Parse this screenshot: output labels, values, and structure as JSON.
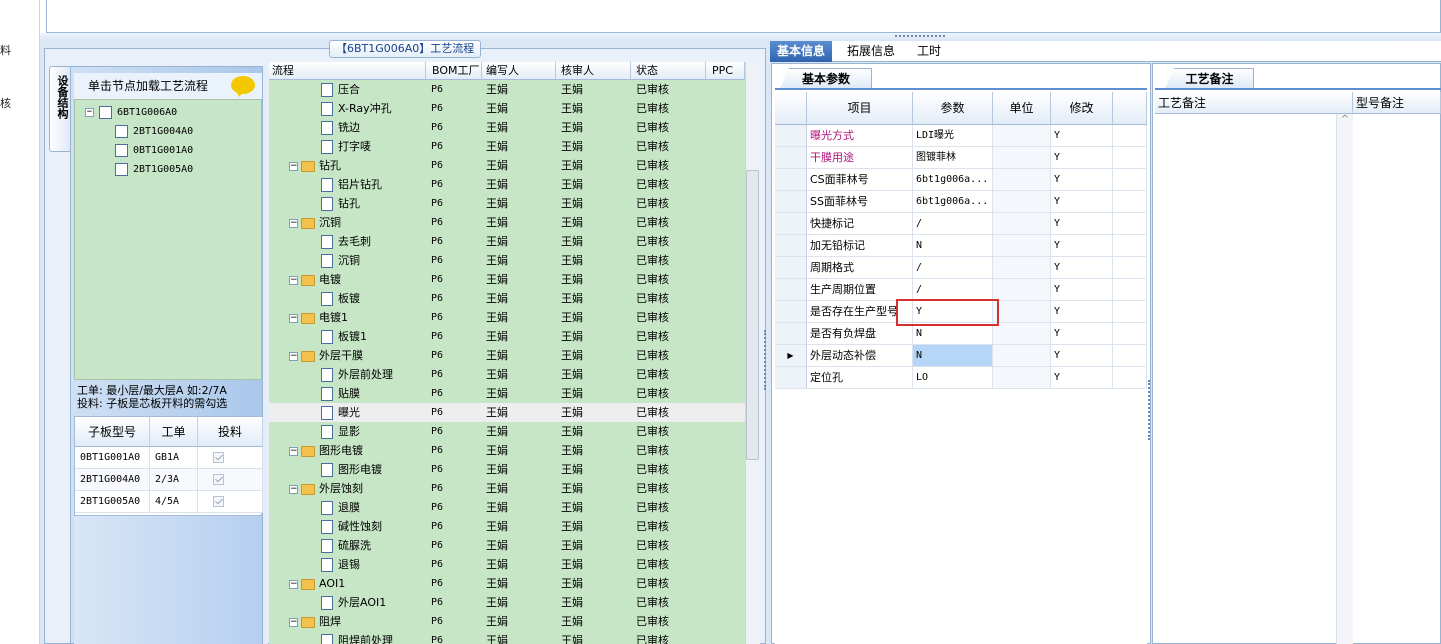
{
  "left_strip": [
    "料",
    "核"
  ],
  "main_title": "【6BT1G006A0】工艺流程",
  "vertical_tab": "设备结构",
  "load_header": "单击节点加载工艺流程",
  "device_tree": {
    "root": "6BT1G006A0",
    "children": [
      "2BT1G004A0",
      "0BT1G001A0",
      "2BT1G005A0"
    ]
  },
  "notes": {
    "line1": "工单: 最小层/最大层A 如:2/7A",
    "line2": "投料: 子板是芯板开料的需勾选"
  },
  "sub_table": {
    "headers": [
      "子板型号",
      "工单",
      "投料"
    ],
    "rows": [
      {
        "model": "0BT1G001A0",
        "order": "GB1A",
        "checked": true
      },
      {
        "model": "2BT1G004A0",
        "order": "2/3A",
        "checked": true
      },
      {
        "model": "2BT1G005A0",
        "order": "4/5A",
        "checked": true
      }
    ]
  },
  "process_grid": {
    "headers": [
      "流程",
      "BOM工厂",
      "编写人",
      "核审人",
      "状态",
      "PPC"
    ],
    "rows": [
      {
        "name": "压合",
        "level": 2,
        "bom": "P6",
        "writer": "王娟",
        "reviewer": "王娟",
        "status": "已审核"
      },
      {
        "name": "X-Ray冲孔",
        "level": 2,
        "bom": "P6",
        "writer": "王娟",
        "reviewer": "王娟",
        "status": "已审核"
      },
      {
        "name": "铣边",
        "level": 2,
        "bom": "P6",
        "writer": "王娟",
        "reviewer": "王娟",
        "status": "已审核"
      },
      {
        "name": "打字唛",
        "level": 2,
        "bom": "P6",
        "writer": "王娟",
        "reviewer": "王娟",
        "status": "已审核"
      },
      {
        "name": "钻孔",
        "level": 1,
        "bom": "P6",
        "writer": "王娟",
        "reviewer": "王娟",
        "status": "已审核"
      },
      {
        "name": "铝片钻孔",
        "level": 2,
        "bom": "P6",
        "writer": "王娟",
        "reviewer": "王娟",
        "status": "已审核"
      },
      {
        "name": "钻孔",
        "level": 2,
        "bom": "P6",
        "writer": "王娟",
        "reviewer": "王娟",
        "status": "已审核"
      },
      {
        "name": "沉铜",
        "level": 1,
        "bom": "P6",
        "writer": "王娟",
        "reviewer": "王娟",
        "status": "已审核"
      },
      {
        "name": "去毛刺",
        "level": 2,
        "bom": "P6",
        "writer": "王娟",
        "reviewer": "王娟",
        "status": "已审核"
      },
      {
        "name": "沉铜",
        "level": 2,
        "bom": "P6",
        "writer": "王娟",
        "reviewer": "王娟",
        "status": "已审核"
      },
      {
        "name": "电镀",
        "level": 1,
        "bom": "P6",
        "writer": "王娟",
        "reviewer": "王娟",
        "status": "已审核"
      },
      {
        "name": "板镀",
        "level": 2,
        "bom": "P6",
        "writer": "王娟",
        "reviewer": "王娟",
        "status": "已审核"
      },
      {
        "name": "电镀1",
        "level": 1,
        "bom": "P6",
        "writer": "王娟",
        "reviewer": "王娟",
        "status": "已审核"
      },
      {
        "name": "板镀1",
        "level": 2,
        "bom": "P6",
        "writer": "王娟",
        "reviewer": "王娟",
        "status": "已审核"
      },
      {
        "name": "外层干膜",
        "level": 1,
        "bom": "P6",
        "writer": "王娟",
        "reviewer": "王娟",
        "status": "已审核"
      },
      {
        "name": "外层前处理",
        "level": 2,
        "bom": "P6",
        "writer": "王娟",
        "reviewer": "王娟",
        "status": "已审核"
      },
      {
        "name": "贴膜",
        "level": 2,
        "bom": "P6",
        "writer": "王娟",
        "reviewer": "王娟",
        "status": "已审核"
      },
      {
        "name": "曝光",
        "level": 2,
        "bom": "P6",
        "writer": "王娟",
        "reviewer": "王娟",
        "status": "已审核",
        "selected": true
      },
      {
        "name": "显影",
        "level": 2,
        "bom": "P6",
        "writer": "王娟",
        "reviewer": "王娟",
        "status": "已审核"
      },
      {
        "name": "图形电镀",
        "level": 1,
        "bom": "P6",
        "writer": "王娟",
        "reviewer": "王娟",
        "status": "已审核"
      },
      {
        "name": "图形电镀",
        "level": 2,
        "bom": "P6",
        "writer": "王娟",
        "reviewer": "王娟",
        "status": "已审核"
      },
      {
        "name": "外层蚀刻",
        "level": 1,
        "bom": "P6",
        "writer": "王娟",
        "reviewer": "王娟",
        "status": "已审核"
      },
      {
        "name": "退膜",
        "level": 2,
        "bom": "P6",
        "writer": "王娟",
        "reviewer": "王娟",
        "status": "已审核"
      },
      {
        "name": "碱性蚀刻",
        "level": 2,
        "bom": "P6",
        "writer": "王娟",
        "reviewer": "王娟",
        "status": "已审核"
      },
      {
        "name": "硫脲洗",
        "level": 2,
        "bom": "P6",
        "writer": "王娟",
        "reviewer": "王娟",
        "status": "已审核"
      },
      {
        "name": "退锡",
        "level": 2,
        "bom": "P6",
        "writer": "王娟",
        "reviewer": "王娟",
        "status": "已审核"
      },
      {
        "name": "AOI1",
        "level": 1,
        "bom": "P6",
        "writer": "王娟",
        "reviewer": "王娟",
        "status": "已审核"
      },
      {
        "name": "外层AOI1",
        "level": 2,
        "bom": "P6",
        "writer": "王娟",
        "reviewer": "王娟",
        "status": "已审核"
      },
      {
        "name": "阻焊",
        "level": 1,
        "bom": "P6",
        "writer": "王娟",
        "reviewer": "王娟",
        "status": "已审核"
      },
      {
        "name": "阻焊前处理",
        "level": 2,
        "bom": "P6",
        "writer": "王娟",
        "reviewer": "王娟",
        "status": "已审核"
      }
    ]
  },
  "right_tabs": [
    "基本信息",
    "拓展信息",
    "工时"
  ],
  "basic_subtab": "基本参数",
  "basic_grid": {
    "headers": [
      "项目",
      "参数",
      "单位",
      "修改"
    ],
    "rows": [
      {
        "item": "曝光方式",
        "param": "LDI曝光",
        "unit": "",
        "edit": "Y",
        "highlight": true
      },
      {
        "item": "干膜用途",
        "param": "图镀菲林",
        "unit": "",
        "edit": "Y",
        "highlight": true
      },
      {
        "item": "CS面菲林号",
        "param": "6bt1g006a...",
        "unit": "",
        "edit": "Y"
      },
      {
        "item": "SS面菲林号",
        "param": "6bt1g006a...",
        "unit": "",
        "edit": "Y"
      },
      {
        "item": "快捷标记",
        "param": "/",
        "unit": "",
        "edit": "Y"
      },
      {
        "item": "加无铅标记",
        "param": "N",
        "unit": "",
        "edit": "Y"
      },
      {
        "item": "周期格式",
        "param": "/",
        "unit": "",
        "edit": "Y"
      },
      {
        "item": "生产周期位置",
        "param": "/",
        "unit": "",
        "edit": "Y"
      },
      {
        "item": "是否存在生产型号",
        "param": "Y",
        "unit": "",
        "edit": "Y"
      },
      {
        "item": "是否有负焊盘",
        "param": "N",
        "unit": "",
        "edit": "Y"
      },
      {
        "item": "外层动态补偿",
        "param": "N",
        "unit": "",
        "edit": "Y",
        "current": true
      },
      {
        "item": "定位孔",
        "param": "LO",
        "unit": "",
        "edit": "Y"
      }
    ]
  },
  "craft_subtab": "工艺备注",
  "craft_headers": [
    "工艺备注",
    "型号备注"
  ],
  "colors": {
    "highlight_text": "#b0157a",
    "selected_cell": "#b7d5f7",
    "green_bg": "#c6e6c6",
    "red_box": "#d43030"
  }
}
